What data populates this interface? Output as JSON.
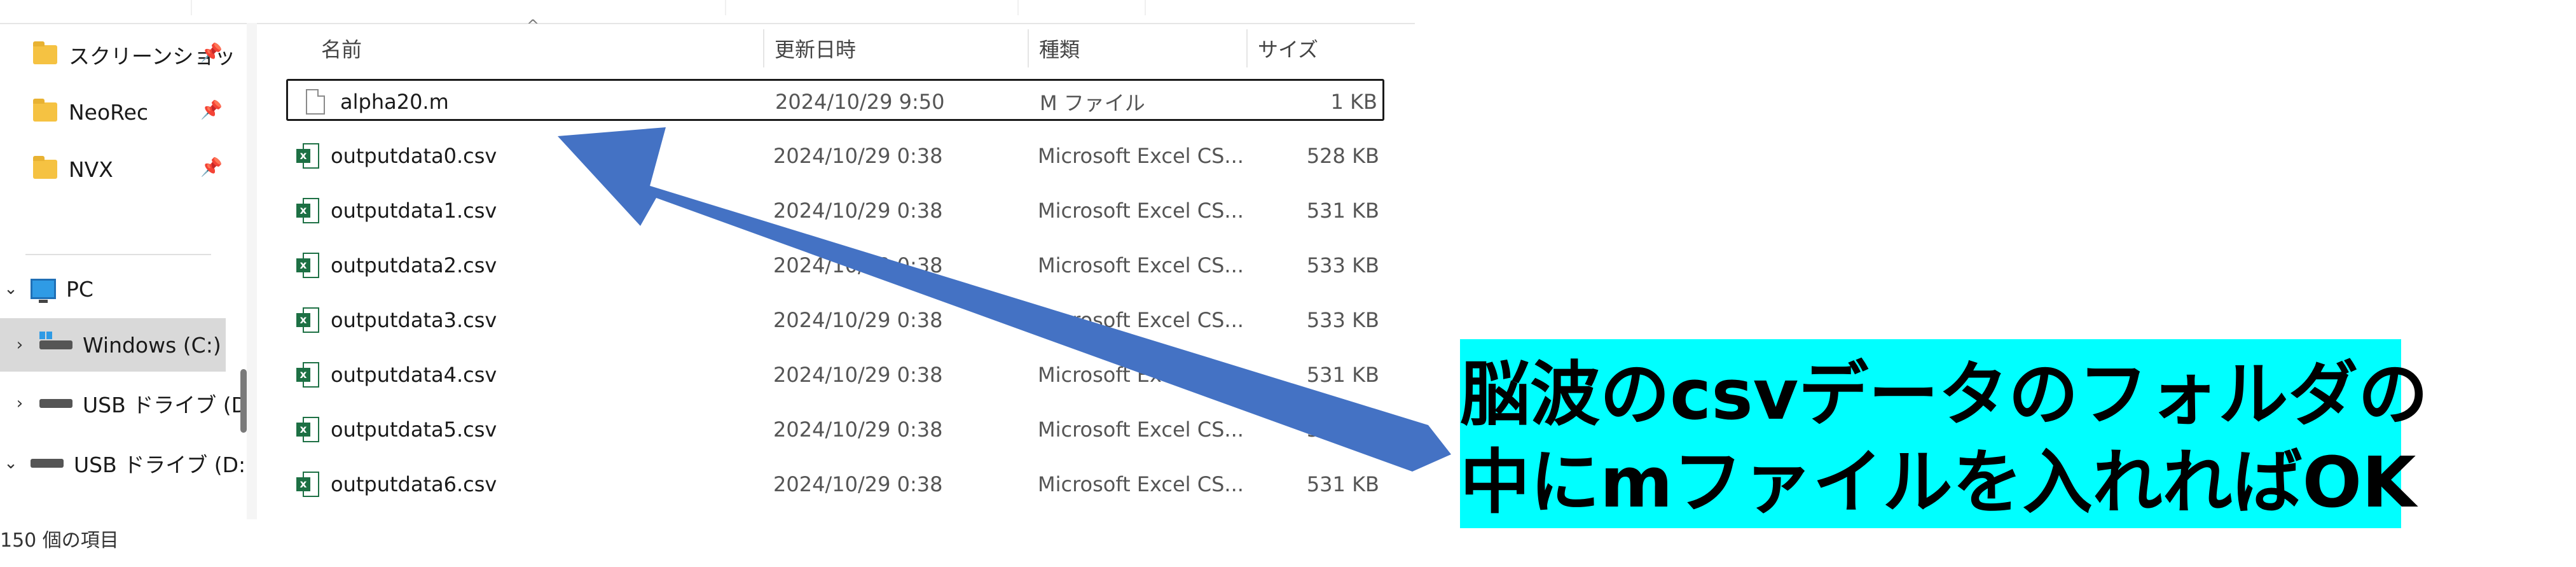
{
  "sidebar": {
    "quick_access": [
      {
        "label": "スクリーンショッ",
        "icon": "folder-icon",
        "pinned": true
      },
      {
        "label": "NeoRec",
        "icon": "folder-icon",
        "pinned": true
      },
      {
        "label": "NVX",
        "icon": "folder-icon",
        "pinned": true
      }
    ],
    "tree": [
      {
        "label": "PC",
        "expanded": true
      },
      {
        "label": "Windows (C:)",
        "expanded": false,
        "selected": true
      },
      {
        "label": "USB ドライブ (D:",
        "expanded": false
      },
      {
        "label": "USB ドライブ (D:)",
        "expanded": true
      }
    ]
  },
  "columns": {
    "name": "名前",
    "date": "更新日時",
    "type": "種類",
    "size": "サイズ"
  },
  "files": [
    {
      "name": "alpha20.m",
      "date": "2024/10/29 9:50",
      "type": "M ファイル",
      "size": "1 KB",
      "icon": "text-file-icon"
    },
    {
      "name": "outputdata0.csv",
      "date": "2024/10/29 0:38",
      "type": "Microsoft Excel CS...",
      "size": "528 KB",
      "icon": "excel-csv-icon"
    },
    {
      "name": "outputdata1.csv",
      "date": "2024/10/29 0:38",
      "type": "Microsoft Excel CS...",
      "size": "531 KB",
      "icon": "excel-csv-icon"
    },
    {
      "name": "outputdata2.csv",
      "date": "2024/10/29 0:38",
      "type": "Microsoft Excel CS...",
      "size": "533 KB",
      "icon": "excel-csv-icon"
    },
    {
      "name": "outputdata3.csv",
      "date": "2024/10/29 0:38",
      "type": "Microsoft Excel CS...",
      "size": "533 KB",
      "icon": "excel-csv-icon"
    },
    {
      "name": "outputdata4.csv",
      "date": "2024/10/29 0:38",
      "type": "Microsoft Excel CS...",
      "size": "531 KB",
      "icon": "excel-csv-icon"
    },
    {
      "name": "outputdata5.csv",
      "date": "2024/10/29 0:38",
      "type": "Microsoft Excel CS...",
      "size": "532 KB",
      "icon": "excel-csv-icon"
    },
    {
      "name": "outputdata6.csv",
      "date": "2024/10/29 0:38",
      "type": "Microsoft Excel CS...",
      "size": "531 KB",
      "icon": "excel-csv-icon"
    }
  ],
  "status": {
    "item_count": "150 個の項目"
  },
  "annotation": {
    "line1": "脳波のcsvデータのフォルダの",
    "line2": "中にmファイルを入れればOK",
    "highlight_color": "#00ffff",
    "arrow_color": "#4472c4"
  }
}
